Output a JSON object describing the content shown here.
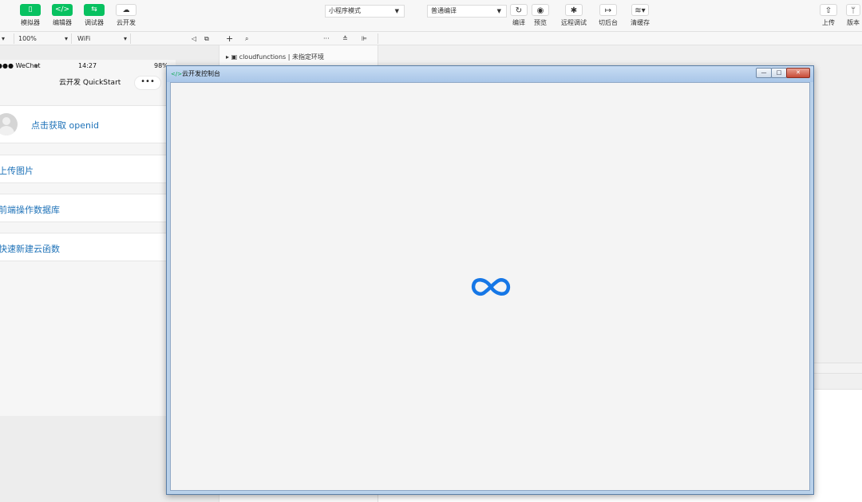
{
  "toolbar": {
    "simulator": "模拟器",
    "editor": "编辑器",
    "debugger": "调试器",
    "cloud": "云开发",
    "mode_select": "小程序模式",
    "compile_select": "普通编译",
    "compile": "编译",
    "preview": "预览",
    "remote_debug": "远程调试",
    "background": "切后台",
    "clear_cache": "清缓存",
    "upload": "上传",
    "version": "版本"
  },
  "subbar": {
    "zoom": "100%",
    "network": "WiFi"
  },
  "phone": {
    "status_signal": "●●● WeChat",
    "status_time": "14:27",
    "status_battery": "98%",
    "nav_title": "云开发 QuickStart",
    "capsule": "•••",
    "items": [
      {
        "label": "点击获取 openid"
      },
      {
        "label": "上传图片"
      },
      {
        "label": "前端操作数据库"
      },
      {
        "label": "快速新建云函数"
      }
    ]
  },
  "files": {
    "cloudfunctions": "cloudfunctions | 未指定环境"
  },
  "window": {
    "title": "云开发控制台",
    "min": "—",
    "max": "□",
    "close": "✕"
  },
  "colors": {
    "accent": "#07c160",
    "link": "#1e72b8",
    "loader": "#1677e6"
  }
}
